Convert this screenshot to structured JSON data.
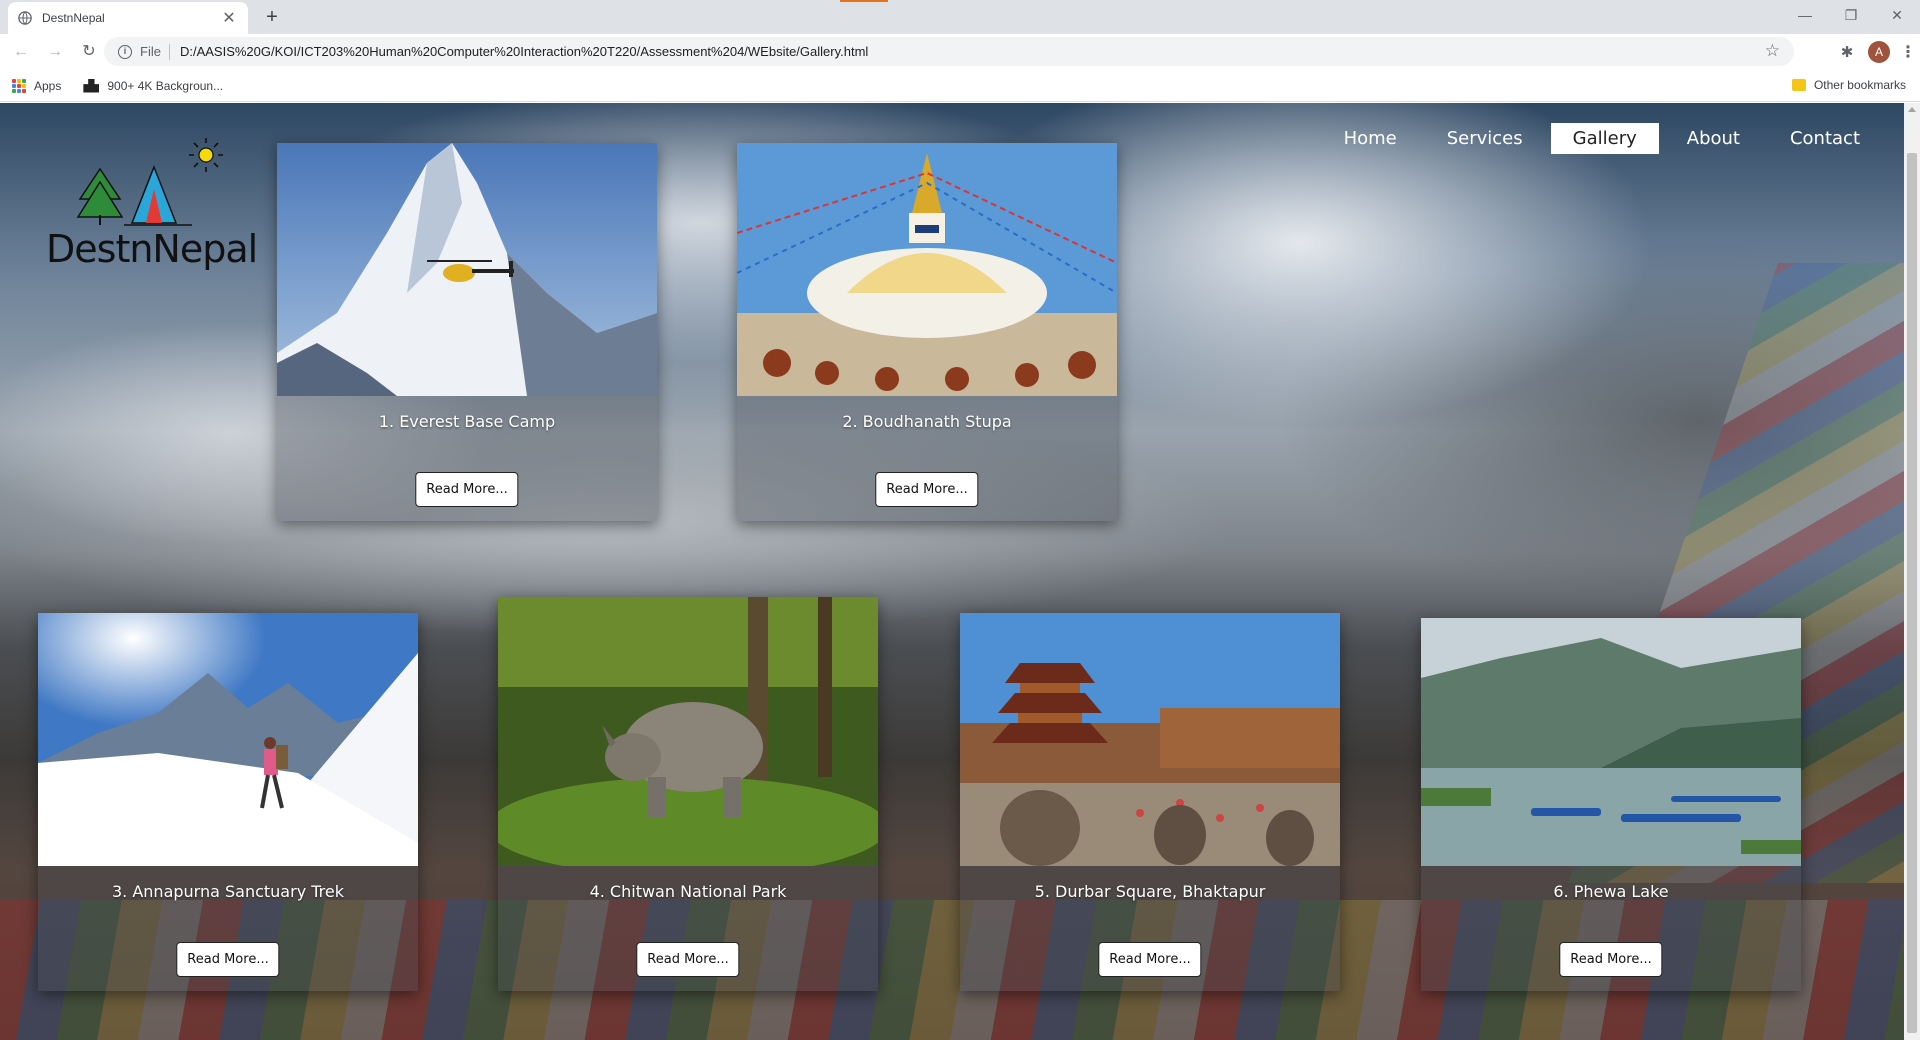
{
  "browser": {
    "tab_title": "DestnNepal",
    "url_scheme": "File",
    "url": "D:/AASIS%20G/KOI/ICT203%20Human%20Computer%20Interaction%20T220/Assessment%204/WEbsite/Gallery.html",
    "avatar_letter": "A",
    "bookmarks": {
      "apps_label": "Apps",
      "item_label": "900+ 4K Backgroun...",
      "other_label": "Other bookmarks"
    }
  },
  "site": {
    "logo_text": "DestnNepal",
    "nav": [
      {
        "label": "Home",
        "active": false
      },
      {
        "label": "Services",
        "active": false
      },
      {
        "label": "Gallery",
        "active": true
      },
      {
        "label": "About",
        "active": false
      },
      {
        "label": "Contact",
        "active": false
      }
    ],
    "cards": [
      {
        "title": "1. Everest Base Camp",
        "button": "Read More..."
      },
      {
        "title": "2. Boudhanath Stupa",
        "button": "Read More..."
      },
      {
        "title": "3. Annapurna Sanctuary Trek",
        "button": "Read More..."
      },
      {
        "title": "4. Chitwan National Park",
        "button": "Read More..."
      },
      {
        "title": "5. Durbar Square, Bhaktapur",
        "button": "Read More..."
      },
      {
        "title": "6. Phewa Lake",
        "button": "Read More..."
      }
    ]
  },
  "colors": {
    "chrome_tabstrip": "#dee1e6",
    "nav_active_bg": "#ffffff",
    "sun": "#f5d90a",
    "tree": "#2e8b3a",
    "tent": "#2aa7d8"
  }
}
